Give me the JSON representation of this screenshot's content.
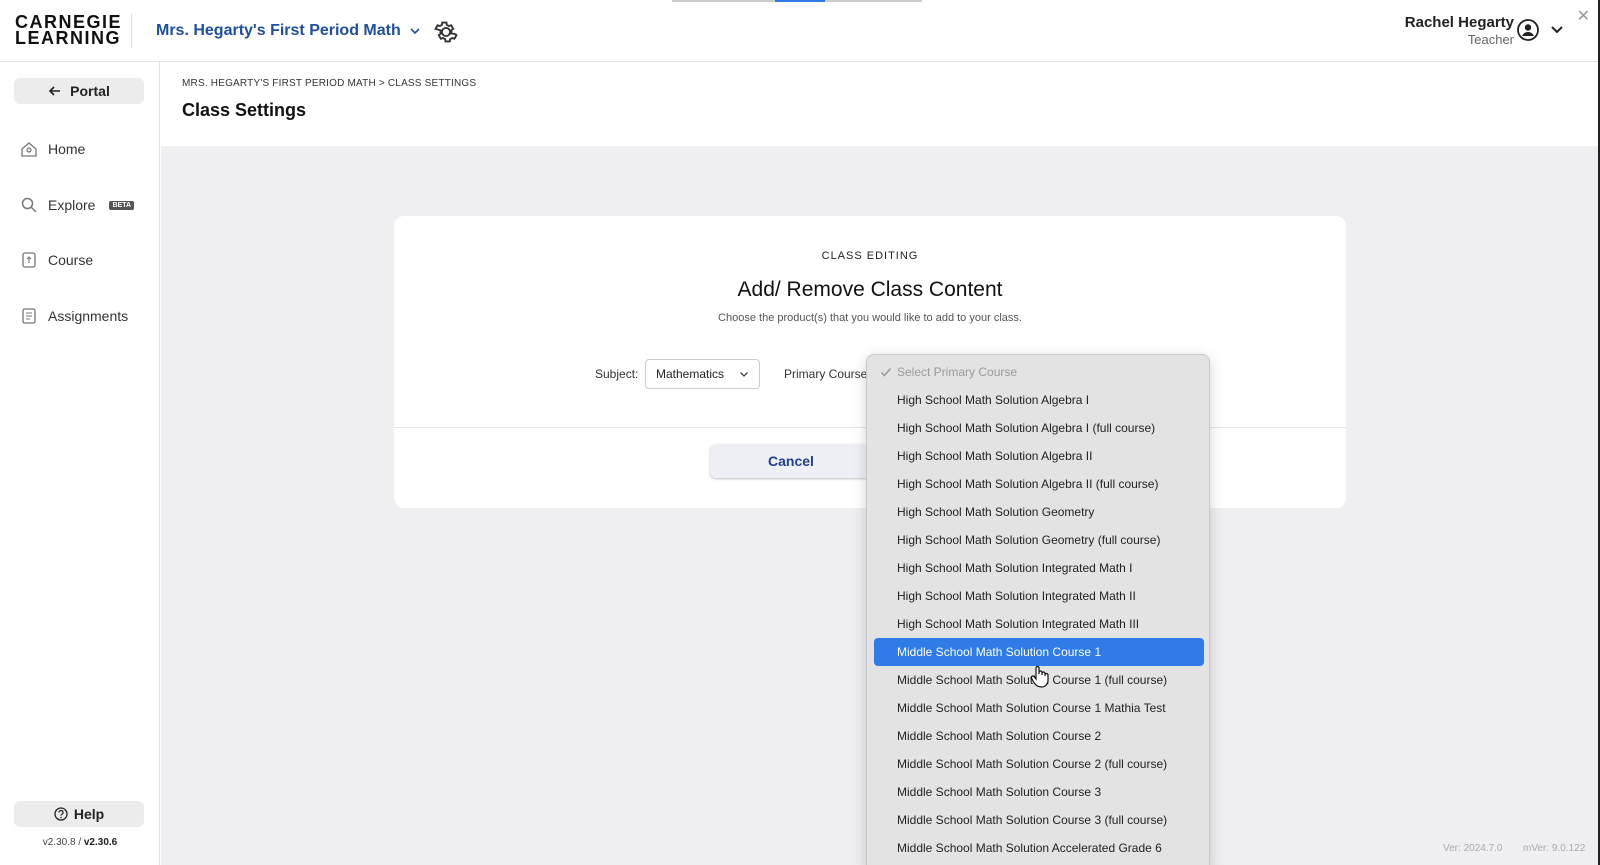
{
  "header": {
    "logo_line1": "CARNEGIE",
    "logo_line2": "LEARNING",
    "class_name": "Mrs. Hegarty's First Period Math",
    "user_name": "Rachel Hegarty",
    "user_role": "Teacher",
    "close_glyph": "✕",
    "icons": [
      "chevron-down-icon",
      "gear-icon",
      "user-circle-icon",
      "close-icon"
    ]
  },
  "sidebar": {
    "portal_label": "Portal",
    "nav": [
      {
        "label": "Home",
        "icon": "home-icon"
      },
      {
        "label": "Explore",
        "icon": "search-icon",
        "badge": "BETA"
      },
      {
        "label": "Course",
        "icon": "course-icon"
      },
      {
        "label": "Assignments",
        "icon": "assignments-icon"
      }
    ],
    "help_label": "Help",
    "version_a": "v2.30.8 /",
    "version_b": "v2.30.6"
  },
  "main": {
    "breadcrumb": "MRS. HEGARTY'S FIRST PERIOD MATH > CLASS SETTINGS",
    "page_title": "Class Settings"
  },
  "card": {
    "eyebrow": "CLASS EDITING",
    "title": "Add/ Remove Class Content",
    "subtitle": "Choose the product(s) that you would like to add to your class.",
    "subject_label": "Subject:",
    "subject_value": "Mathematics",
    "course_label": "Primary Course",
    "cancel_label": "Cancel"
  },
  "dropdown": {
    "placeholder": "Select Primary Course",
    "selected_index": 9,
    "options": [
      "High School Math Solution Algebra I",
      "High School Math Solution Algebra I (full course)",
      "High School Math Solution Algebra II",
      "High School Math Solution Algebra II (full course)",
      "High School Math Solution Geometry",
      "High School Math Solution Geometry (full course)",
      "High School Math Solution Integrated Math I",
      "High School Math Solution Integrated Math II",
      "High School Math Solution Integrated Math III",
      "Middle School Math Solution Course 1",
      "Middle School Math Solution Course 1 (full course)",
      "Middle School Math Solution Course 1 Mathia Test",
      "Middle School Math Solution Course 2",
      "Middle School Math Solution Course 2 (full course)",
      "Middle School Math Solution Course 3",
      "Middle School Math Solution Course 3 (full course)",
      "Middle School Math Solution Accelerated Grade 6"
    ]
  },
  "footer": {
    "ver": "Ver: 2024.7.0",
    "mver": "mVer: 9.0.122"
  },
  "colors": {
    "brand_blue": "#1f4fa0",
    "selected_blue": "#2f7be8",
    "page_bg": "#efeff1"
  }
}
